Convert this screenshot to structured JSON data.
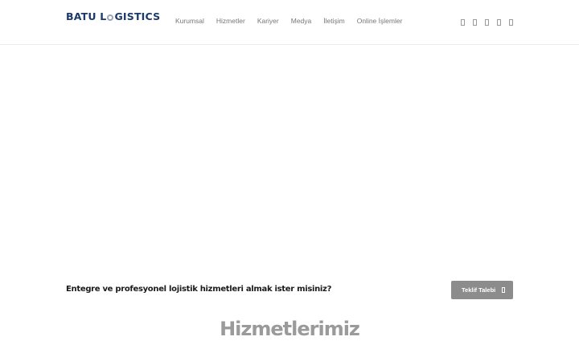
{
  "header": {
    "logo_left": "BATU L",
    "logo_right": "GISTICS",
    "nav": [
      "Kurumsal",
      "Hizmetler",
      "Kariyer",
      "Medya",
      "İletişim",
      "Online İşlemler"
    ],
    "social_icons": [
      "facebook-icon",
      "twitter-icon",
      "instagram-icon",
      "linkedin-icon",
      "youtube-icon"
    ]
  },
  "cta": {
    "text": "Entegre ve profesyonel lojistik hizmetleri almak ister misiniz?",
    "button_label": "Teklif Talebi"
  },
  "services": {
    "title": "Hizmetlerimiz"
  },
  "colors": {
    "brand": "#1b3a6b",
    "button": "#8c8c8c",
    "title_gray": "#9a9a9a"
  }
}
